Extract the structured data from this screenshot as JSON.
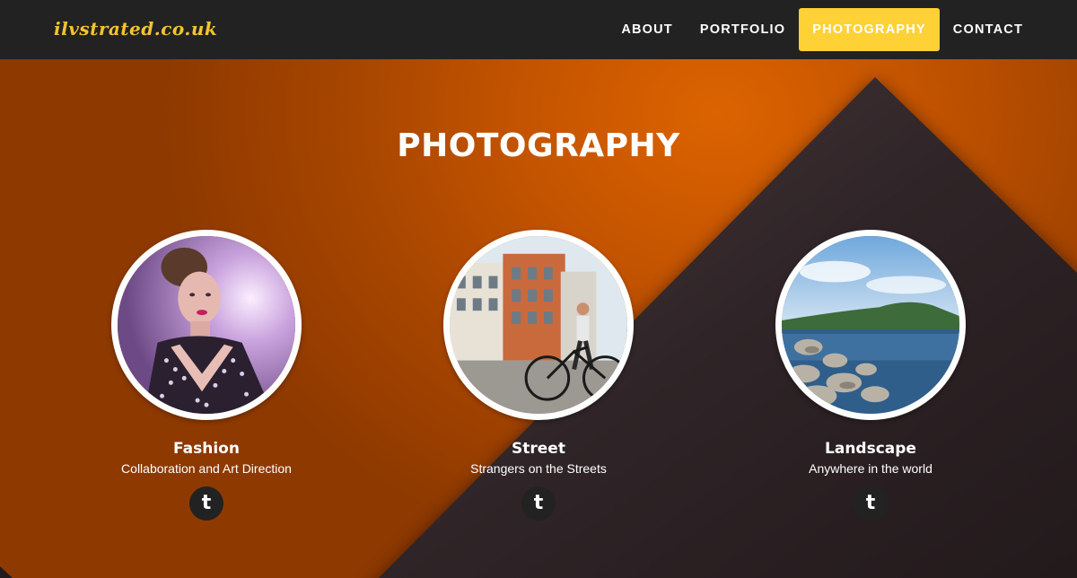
{
  "navbar": {
    "logo": "ilvstrated.co.uk",
    "items": [
      {
        "label": "ABOUT",
        "active": false
      },
      {
        "label": "PORTFOLIO",
        "active": false
      },
      {
        "label": "PHOTOGRAPHY",
        "active": true
      },
      {
        "label": "CONTACT",
        "active": false
      }
    ]
  },
  "section": {
    "title": "PHOTOGRAPHY"
  },
  "cards": [
    {
      "title": "Fashion",
      "subtitle": "Collaboration and Art Direction",
      "icon": "tumblr-icon",
      "icon_glyph": "t"
    },
    {
      "title": "Street",
      "subtitle": "Strangers on the Streets",
      "icon": "tumblr-icon",
      "icon_glyph": "t"
    },
    {
      "title": "Landscape",
      "subtitle": "Anywhere in the world",
      "icon": "tumblr-icon",
      "icon_glyph": "t"
    }
  ],
  "colors": {
    "accent": "#fed136",
    "logo": "#f5c331",
    "navbar": "#222222",
    "orange": "#d35f00",
    "dark": "#2a2022"
  }
}
